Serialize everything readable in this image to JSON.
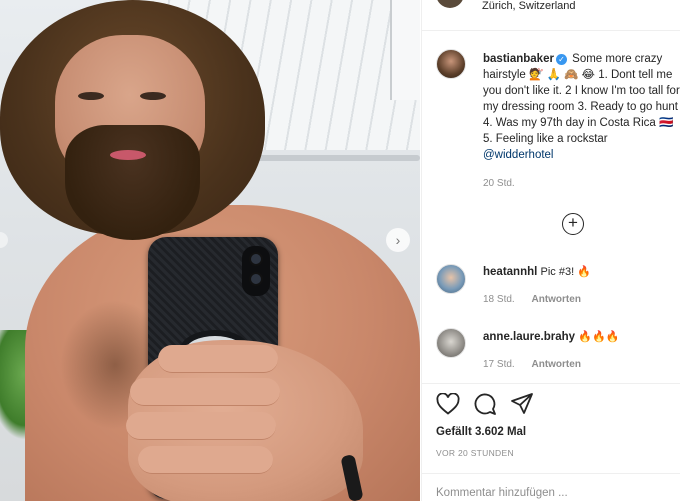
{
  "post": {
    "location": "Zürich, Switzerland",
    "author": "bastianbaker",
    "caption_text": "Some more crazy hairstyle 💇 🙏 🙈 😂 1. Dont tell me you don't like it. 2 I know I'm too tall for my dressing room 3. Ready to go hunt 4. Was my 97th day in Costa Rica 🇨🇷 5. Feeling like a rockstar",
    "caption_mention": "@widderhotel",
    "caption_age": "20 Std."
  },
  "comments": [
    {
      "username": "heatannhl",
      "text": "Pic #3! 🔥",
      "age": "18 Std.",
      "reply_label": "Antworten"
    },
    {
      "username": "anne.laure.brahy",
      "text": "🔥🔥🔥",
      "age": "17 Std.",
      "reply_label": "Antworten"
    }
  ],
  "engagement": {
    "likes": "Gefällt 3.602 Mal",
    "timestamp": "VOR 20 STUNDEN"
  },
  "composer": {
    "placeholder": "Kommentar hinzufügen ..."
  },
  "icons": {
    "like": "heart-icon",
    "comment": "comment-icon",
    "share": "send-icon",
    "load_more": "plus-circle-icon",
    "verified": "verified-badge-icon",
    "carousel_next": "chevron-right-icon"
  },
  "colors": {
    "verified": "#3897f0",
    "mention": "#00376b",
    "secondary_text": "#8e8e8e"
  }
}
